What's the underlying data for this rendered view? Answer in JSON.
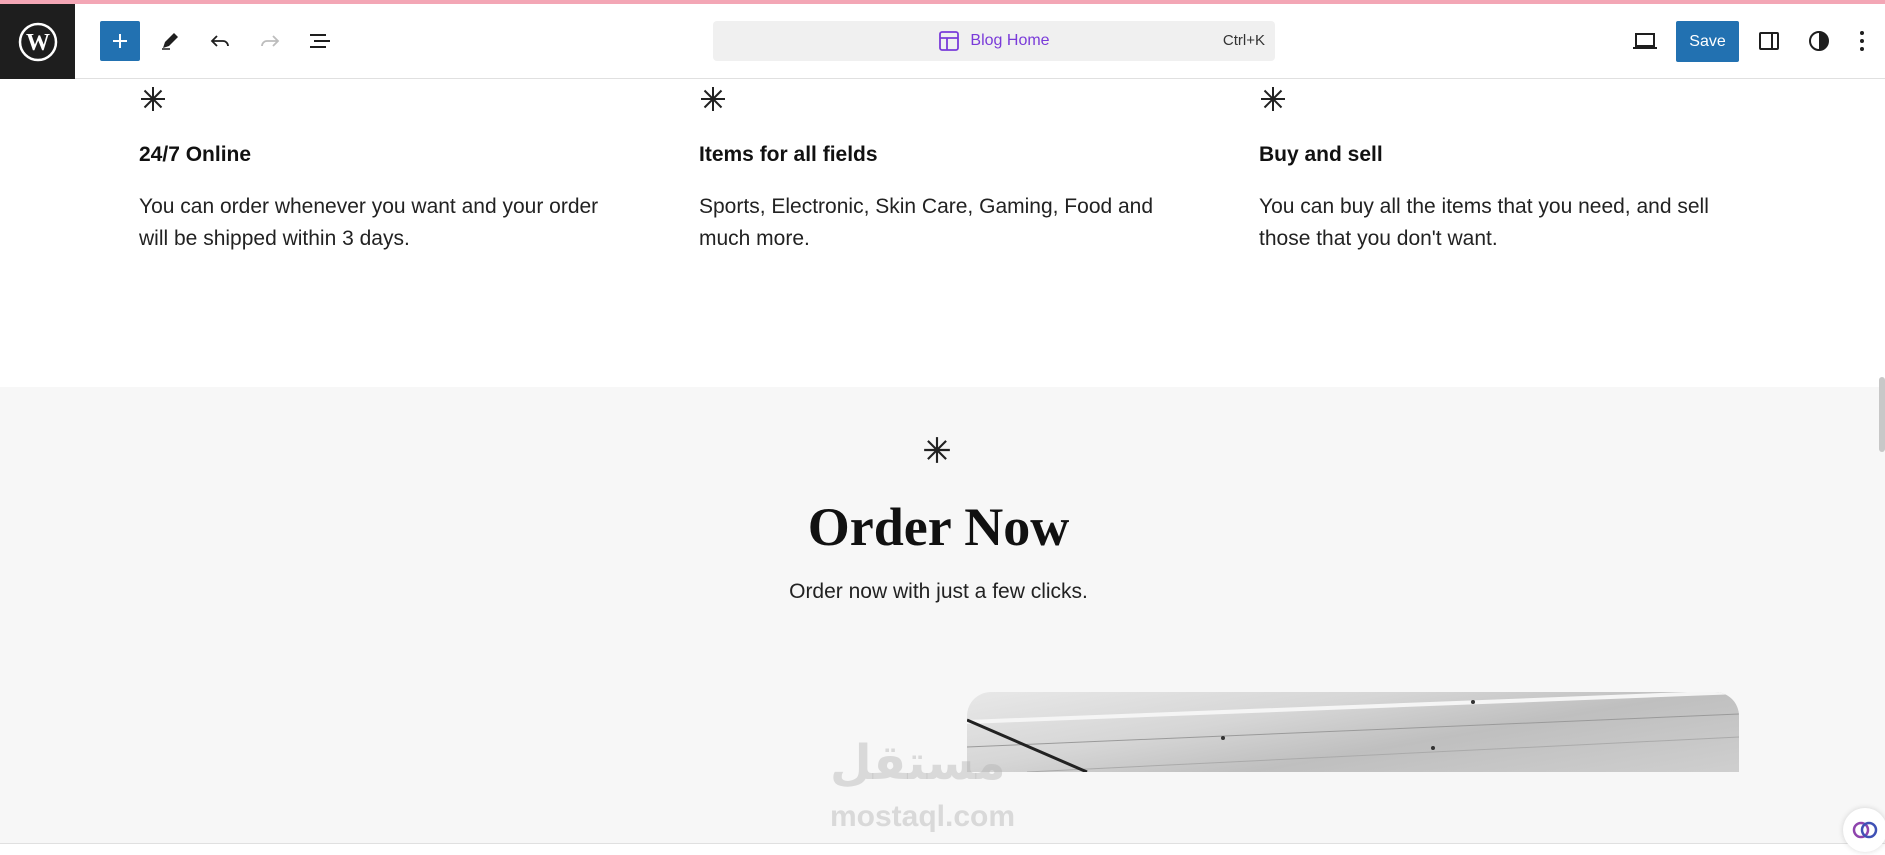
{
  "toolbar": {
    "command_title": "Blog Home",
    "command_shortcut": "Ctrl+K",
    "save_label": "Save"
  },
  "features": [
    {
      "title": "24/7 Online",
      "text": "You can order whenever you want and your order will be shipped within 3 days."
    },
    {
      "title": "Items for all fields",
      "text": "Sports, Electronic, Skin Care, Gaming, Food and much more."
    },
    {
      "title": "Buy and sell",
      "text": "You can buy all the items that you need, and sell those that you don't want."
    }
  ],
  "order": {
    "title": "Order Now",
    "subtitle": "Order now with just a few clicks."
  },
  "watermark": {
    "arabic": "مستقل",
    "latin": "mostaql.com"
  },
  "colors": {
    "accent": "#2271b1",
    "command_text": "#7a3bd9",
    "top_line": "#f3a6b5"
  }
}
